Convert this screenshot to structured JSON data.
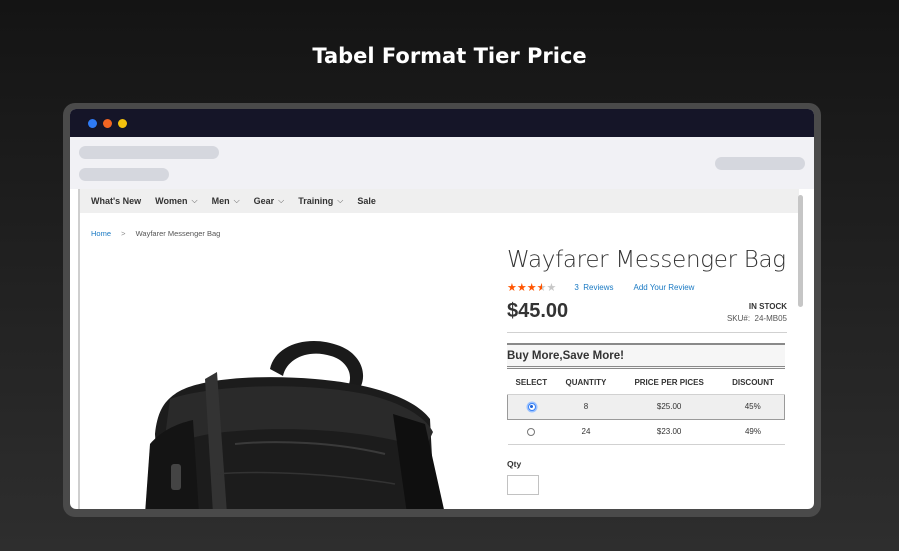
{
  "banner": {
    "title": "Tabel Format Tier Price"
  },
  "nav": {
    "items": [
      {
        "label": "What's New",
        "has_dropdown": false
      },
      {
        "label": "Women",
        "has_dropdown": true
      },
      {
        "label": "Men",
        "has_dropdown": true
      },
      {
        "label": "Gear",
        "has_dropdown": true
      },
      {
        "label": "Training",
        "has_dropdown": true
      },
      {
        "label": "Sale",
        "has_dropdown": false
      }
    ]
  },
  "breadcrumb": {
    "home": "Home",
    "separator": ">",
    "current": "Wayfarer Messenger Bag"
  },
  "product": {
    "title": "Wayfarer Messenger Bag",
    "rating": {
      "stars": 3.5,
      "max": 5
    },
    "reviews_count": "3",
    "reviews_label": "Reviews",
    "add_review": "Add Your Review",
    "price": "$45.00",
    "stock": "IN STOCK",
    "sku_label": "SKU#:",
    "sku": "24-MB05"
  },
  "tier_price": {
    "heading": "Buy More,Save More!",
    "columns": [
      "SELECT",
      "QUANTITY",
      "PRICE PER PICES",
      "DISCOUNT"
    ],
    "rows": [
      {
        "selected": true,
        "quantity": "8",
        "price": "$25.00",
        "discount": "45%"
      },
      {
        "selected": false,
        "quantity": "24",
        "price": "$23.00",
        "discount": "49%"
      }
    ]
  },
  "qty": {
    "label": "Qty"
  },
  "colors": {
    "titlebar": "#151528",
    "link": "#1979c3",
    "star": "#ff5501",
    "dot_blue": "#2f7bf5",
    "dot_orange": "#f26522",
    "dot_yellow": "#f4c20d"
  }
}
